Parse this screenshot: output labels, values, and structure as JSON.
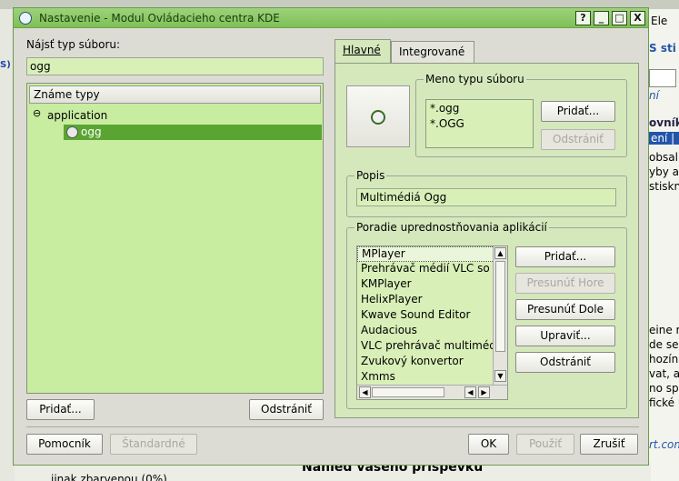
{
  "window": {
    "title": "Nastavenie - Modul Ovládacieho centra KDE",
    "help": "?",
    "minimize": "_",
    "maximize": "□",
    "close": "X"
  },
  "left": {
    "find_label": "Nájsť typ súboru:",
    "search_value": "ogg",
    "list_header": "Známe typy",
    "tree_expander": "⊖",
    "tree_group": "application",
    "tree_item": "ogg",
    "add": "Pridať...",
    "remove": "Odstrániť"
  },
  "tabs": {
    "main": "Hlavné",
    "embedded": "Integrované"
  },
  "mime": {
    "group_title": "Meno typu súboru",
    "patterns": [
      "*.ogg",
      "*.OGG"
    ],
    "add": "Pridať...",
    "remove": "Odstrániť"
  },
  "desc": {
    "title": "Popis",
    "value": "Multimédiá Ogg"
  },
  "apps": {
    "title": "Poradie uprednostňovania aplikácií",
    "items": [
      "MPlayer",
      "Prehrávač médií VLC so s",
      "KMPlayer",
      "HelixPlayer",
      "Kwave Sound Editor",
      "Audacious",
      "VLC prehrávač multimédi",
      "Zvukový konvertor",
      "Xmms"
    ],
    "add": "Pridať...",
    "move_up": "Presunúť Hore",
    "move_down": "Presunúť Dole",
    "edit": "Upraviť...",
    "remove": "Odstrániť"
  },
  "footer": {
    "help": "Pomocník",
    "defaults": "Štandardné",
    "ok": "OK",
    "apply": "Použiť",
    "cancel": "Zrušiť"
  },
  "background": {
    "r1": "S sti",
    "r2": "Ele",
    "r3": "ní",
    "r4": "ovník",
    "r5": "ení | F",
    "r6": "obsal",
    "r7": "yby a",
    "r8": "stiskn",
    "r9": "eine r",
    "r10": "de se",
    "r11": "hozín",
    "r12": "vat, a",
    "r13": "no sp",
    "r14": "fické r",
    "r15": "rt.com",
    "left_s": "S)",
    "bottom_radio": "iinak zbarvenou (0%)",
    "bottom_heading": "Náhled vašeho příspěvku"
  },
  "colors": {
    "accent": "#5aa532",
    "field": "#d8f0b8",
    "titlebar": "#8fc866"
  }
}
